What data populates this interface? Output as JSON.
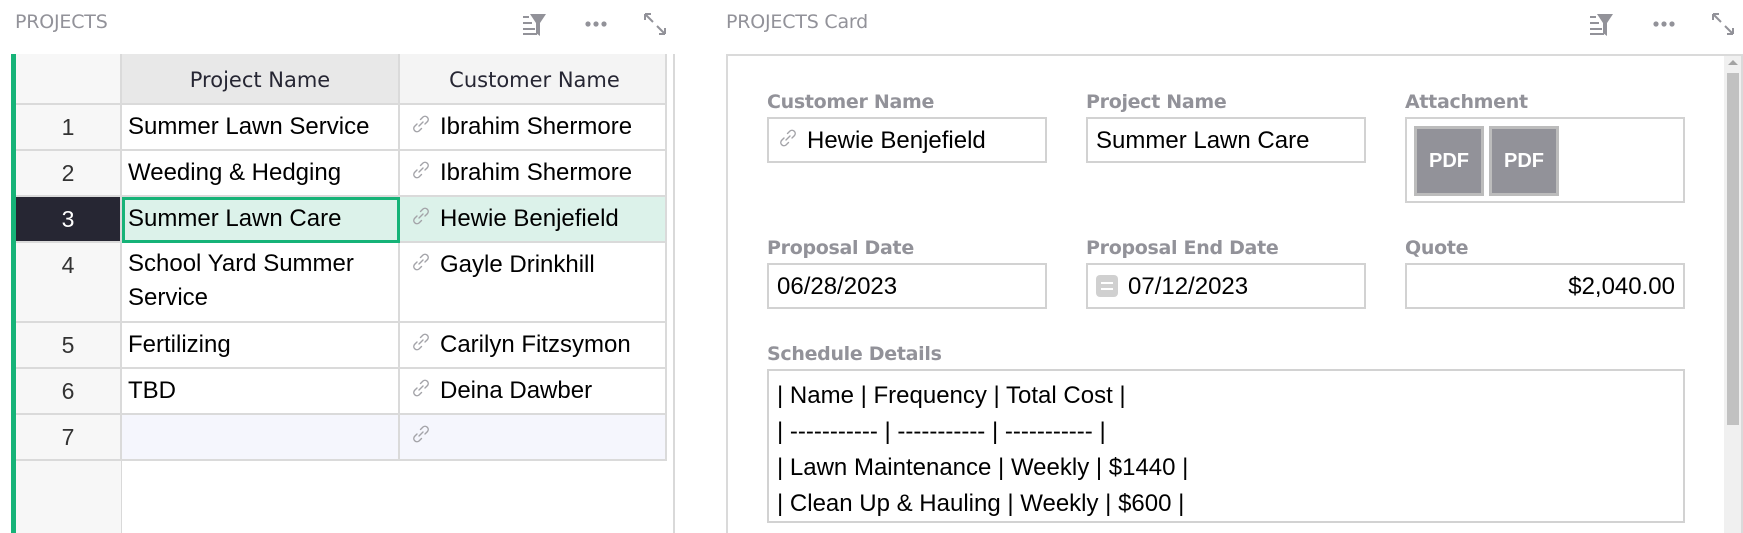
{
  "colors": {
    "accent": "#16b378",
    "selected_row_bg": "#dcf2ea",
    "label_gray": "#929299",
    "row_number_active_bg": "#262633"
  },
  "left_panel": {
    "title": "PROJECTS",
    "icons": [
      "sort-filter-icon",
      "more-options-icon",
      "expand-icon"
    ],
    "columns": [
      "Project Name",
      "Customer Name"
    ],
    "rows": [
      {
        "num": "1",
        "project": "Summer Lawn Service",
        "customer": "Ibrahim Shermore"
      },
      {
        "num": "2",
        "project": "Weeding & Hedging",
        "customer": "Ibrahim Shermore"
      },
      {
        "num": "3",
        "project": "Summer Lawn Care",
        "customer": "Hewie Benjefield"
      },
      {
        "num": "4",
        "project": "School Yard Summer Service",
        "customer": "Gayle Drinkhill"
      },
      {
        "num": "5",
        "project": "Fertilizing",
        "customer": "Carilyn Fitzsymon"
      },
      {
        "num": "6",
        "project": "TBD",
        "customer": "Deina Dawber"
      },
      {
        "num": "7",
        "project": "",
        "customer": ""
      }
    ],
    "selected_row": "3"
  },
  "card_panel": {
    "title": "PROJECTS Card",
    "icons": [
      "sort-filter-icon",
      "more-options-icon",
      "expand-icon"
    ],
    "fields": {
      "customer_name": {
        "label": "Customer Name",
        "value": "Hewie Benjefield"
      },
      "project_name": {
        "label": "Project Name",
        "value": "Summer Lawn Care"
      },
      "attachment": {
        "label": "Attachment",
        "files": [
          "PDF",
          "PDF"
        ]
      },
      "proposal_date": {
        "label": "Proposal Date",
        "value": "06/28/2023"
      },
      "proposal_end_date": {
        "label": "Proposal End Date",
        "value": "07/12/2023"
      },
      "quote": {
        "label": "Quote",
        "value": "$2,040.00"
      },
      "schedule_details": {
        "label": "Schedule Details",
        "lines": [
          "| Name | Frequency | Total Cost |",
          "| ----------- | ----------- | ----------- |",
          "| Lawn Maintenance | Weekly | $1440 |",
          "| Clean Up & Hauling | Weekly | $600 |"
        ]
      }
    }
  }
}
